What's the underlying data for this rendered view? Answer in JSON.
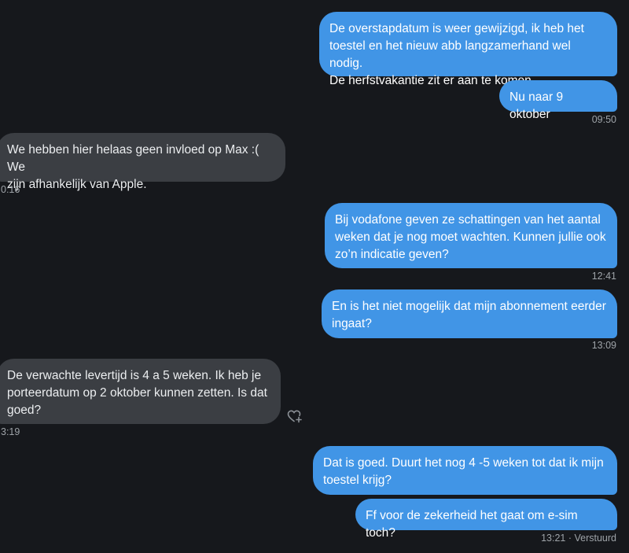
{
  "messages": [
    {
      "text": "De overstapdatum is weer gewijzigd, ik heb het\ntoestel en het nieuw abb langzamerhand wel nodig.\nDe herfstvakantie zit er aan te komen"
    },
    {
      "text": "Nu naar 9 oktober",
      "time": "09:50"
    },
    {
      "text": "We hebben hier helaas geen invloed op Max :( We\nzijn afhankelijk van Apple.",
      "time": "0:16"
    },
    {
      "text": "Bij vodafone geven ze schattingen van het aantal\nweken dat je nog moet wachten. Kunnen jullie ook\nzo’n indicatie geven?",
      "time": "12:41"
    },
    {
      "text": "En is het niet mogelijk dat mijn abonnement eerder\ningaat?",
      "time": "13:09"
    },
    {
      "text": "De verwachte levertijd is 4 a 5 weken. Ik heb je\nporteerdatum op 2 oktober kunnen zetten. Is dat\ngoed?",
      "time": "3:19"
    },
    {
      "text": "Dat is goed. Duurt het nog 4 -5 weken tot dat ik mijn\ntoestel krijg?"
    },
    {
      "text": "Ff voor de zekerheid het gaat om e-sim toch?",
      "time": "13:21 · Verstuurd"
    }
  ],
  "icons": {
    "react": "heart-plus-icon"
  },
  "colors": {
    "background": "#16181c",
    "outgoing": "#4195e6",
    "incoming": "#3b3e43"
  }
}
